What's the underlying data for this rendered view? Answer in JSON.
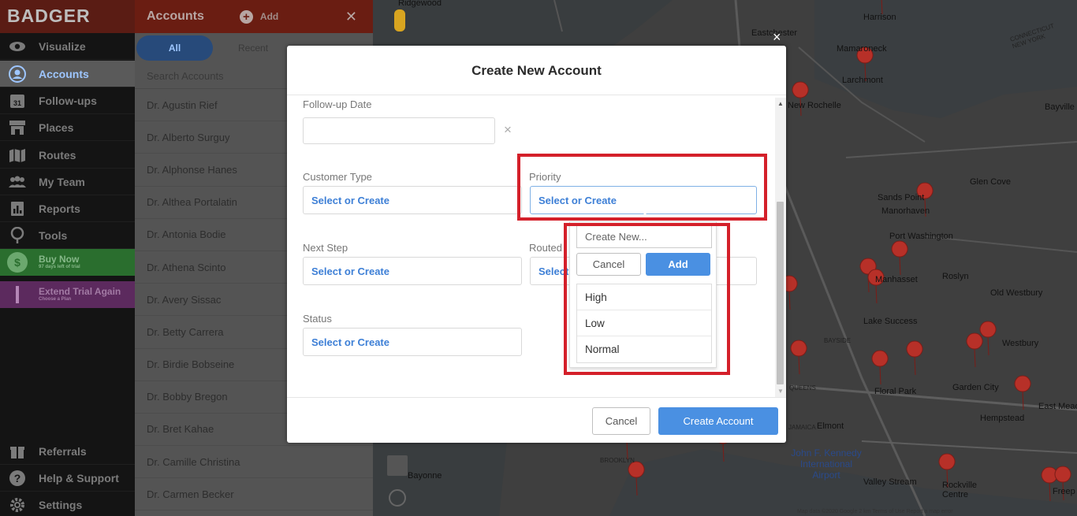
{
  "app": {
    "brand": "BADGER",
    "accent": "#4a90e2",
    "highlight_color": "#d4202a"
  },
  "sidebar": {
    "items": [
      {
        "label": "Visualize",
        "icon": "eye-icon"
      },
      {
        "label": "Accounts",
        "icon": "user-circle-icon",
        "active": true
      },
      {
        "label": "Follow-ups",
        "icon": "calendar-icon"
      },
      {
        "label": "Places",
        "icon": "store-icon"
      },
      {
        "label": "Routes",
        "icon": "map-icon"
      },
      {
        "label": "My Team",
        "icon": "team-icon"
      },
      {
        "label": "Reports",
        "icon": "reports-icon"
      },
      {
        "label": "Tools",
        "icon": "pin-icon"
      }
    ],
    "calendar_day": "31",
    "buy_now": {
      "label": "Buy Now",
      "sub": "97 days left of trial",
      "icon_glyph": "$"
    },
    "extend": {
      "label": "Extend Trial Again",
      "sub": "Choose a Plan"
    },
    "bottom_items": [
      {
        "label": "Referrals",
        "icon": "gift-icon"
      },
      {
        "label": "Help & Support",
        "icon": "help-icon"
      },
      {
        "label": "Settings",
        "icon": "gear-icon"
      }
    ]
  },
  "accounts_panel": {
    "title": "Accounts",
    "add_label": "Add",
    "tabs": {
      "all": "All",
      "recent": "Recent"
    },
    "search_placeholder": "Search Accounts",
    "rows": [
      "Dr. Agustin Rief",
      "Dr. Alberto Surguy",
      "Dr. Alphonse Hanes",
      "Dr. Althea Portalatin",
      "Dr. Antonia Bodie",
      "Dr. Athena Scinto",
      "Dr. Avery Sissac",
      "Dr. Betty Carrera",
      "Dr. Birdie Bobseine",
      "Dr. Bobby Bregon",
      "Dr. Bret Kahae",
      "Dr. Camille Christina",
      "Dr. Carmen Becker"
    ]
  },
  "map": {
    "labels": [
      "Ridgewood",
      "Eastchester",
      "Harrison",
      "Mamaroneck",
      "Larchmont",
      "New Rochelle",
      "Bayville",
      "Glen Cove",
      "Sands Point",
      "Manorhaven",
      "Port Washington",
      "Manhasset",
      "Roslyn",
      "Old Westbury",
      "Lake Success",
      "Westbury",
      "Garden City",
      "Floral Park",
      "Elmont",
      "Hempstead",
      "East Meado",
      "John F. Kennedy International Airport",
      "Valley Stream",
      "Rockville Centre",
      "Freep",
      "Bayonne",
      "BROOKLYN",
      "QUEENS",
      "JAMAICA",
      "BAYSIDE",
      "CONNECTICUT NEW YORK"
    ],
    "footer": "Map data ©2020 Google   2 km   Terms of Use   Report a map error"
  },
  "modal": {
    "close_glyph": "×",
    "title": "Create New Account",
    "fields": {
      "followup_date": {
        "label": "Follow-up Date",
        "value": ""
      },
      "customer_type": {
        "label": "Customer Type",
        "value": "Select or Create"
      },
      "priority": {
        "label": "Priority",
        "value": "Select or Create"
      },
      "next_step": {
        "label": "Next Step",
        "value": "Select or Create"
      },
      "routed": {
        "label": "Routed",
        "value": "Select"
      },
      "status": {
        "label": "Status",
        "value": "Select or Create"
      }
    },
    "clear_glyph": "×",
    "cancel_label": "Cancel",
    "create_label": "Create Account"
  },
  "dropdown": {
    "input_placeholder": "Create New...",
    "cancel_label": "Cancel",
    "add_label": "Add",
    "options": [
      "High",
      "Low",
      "Normal"
    ]
  }
}
